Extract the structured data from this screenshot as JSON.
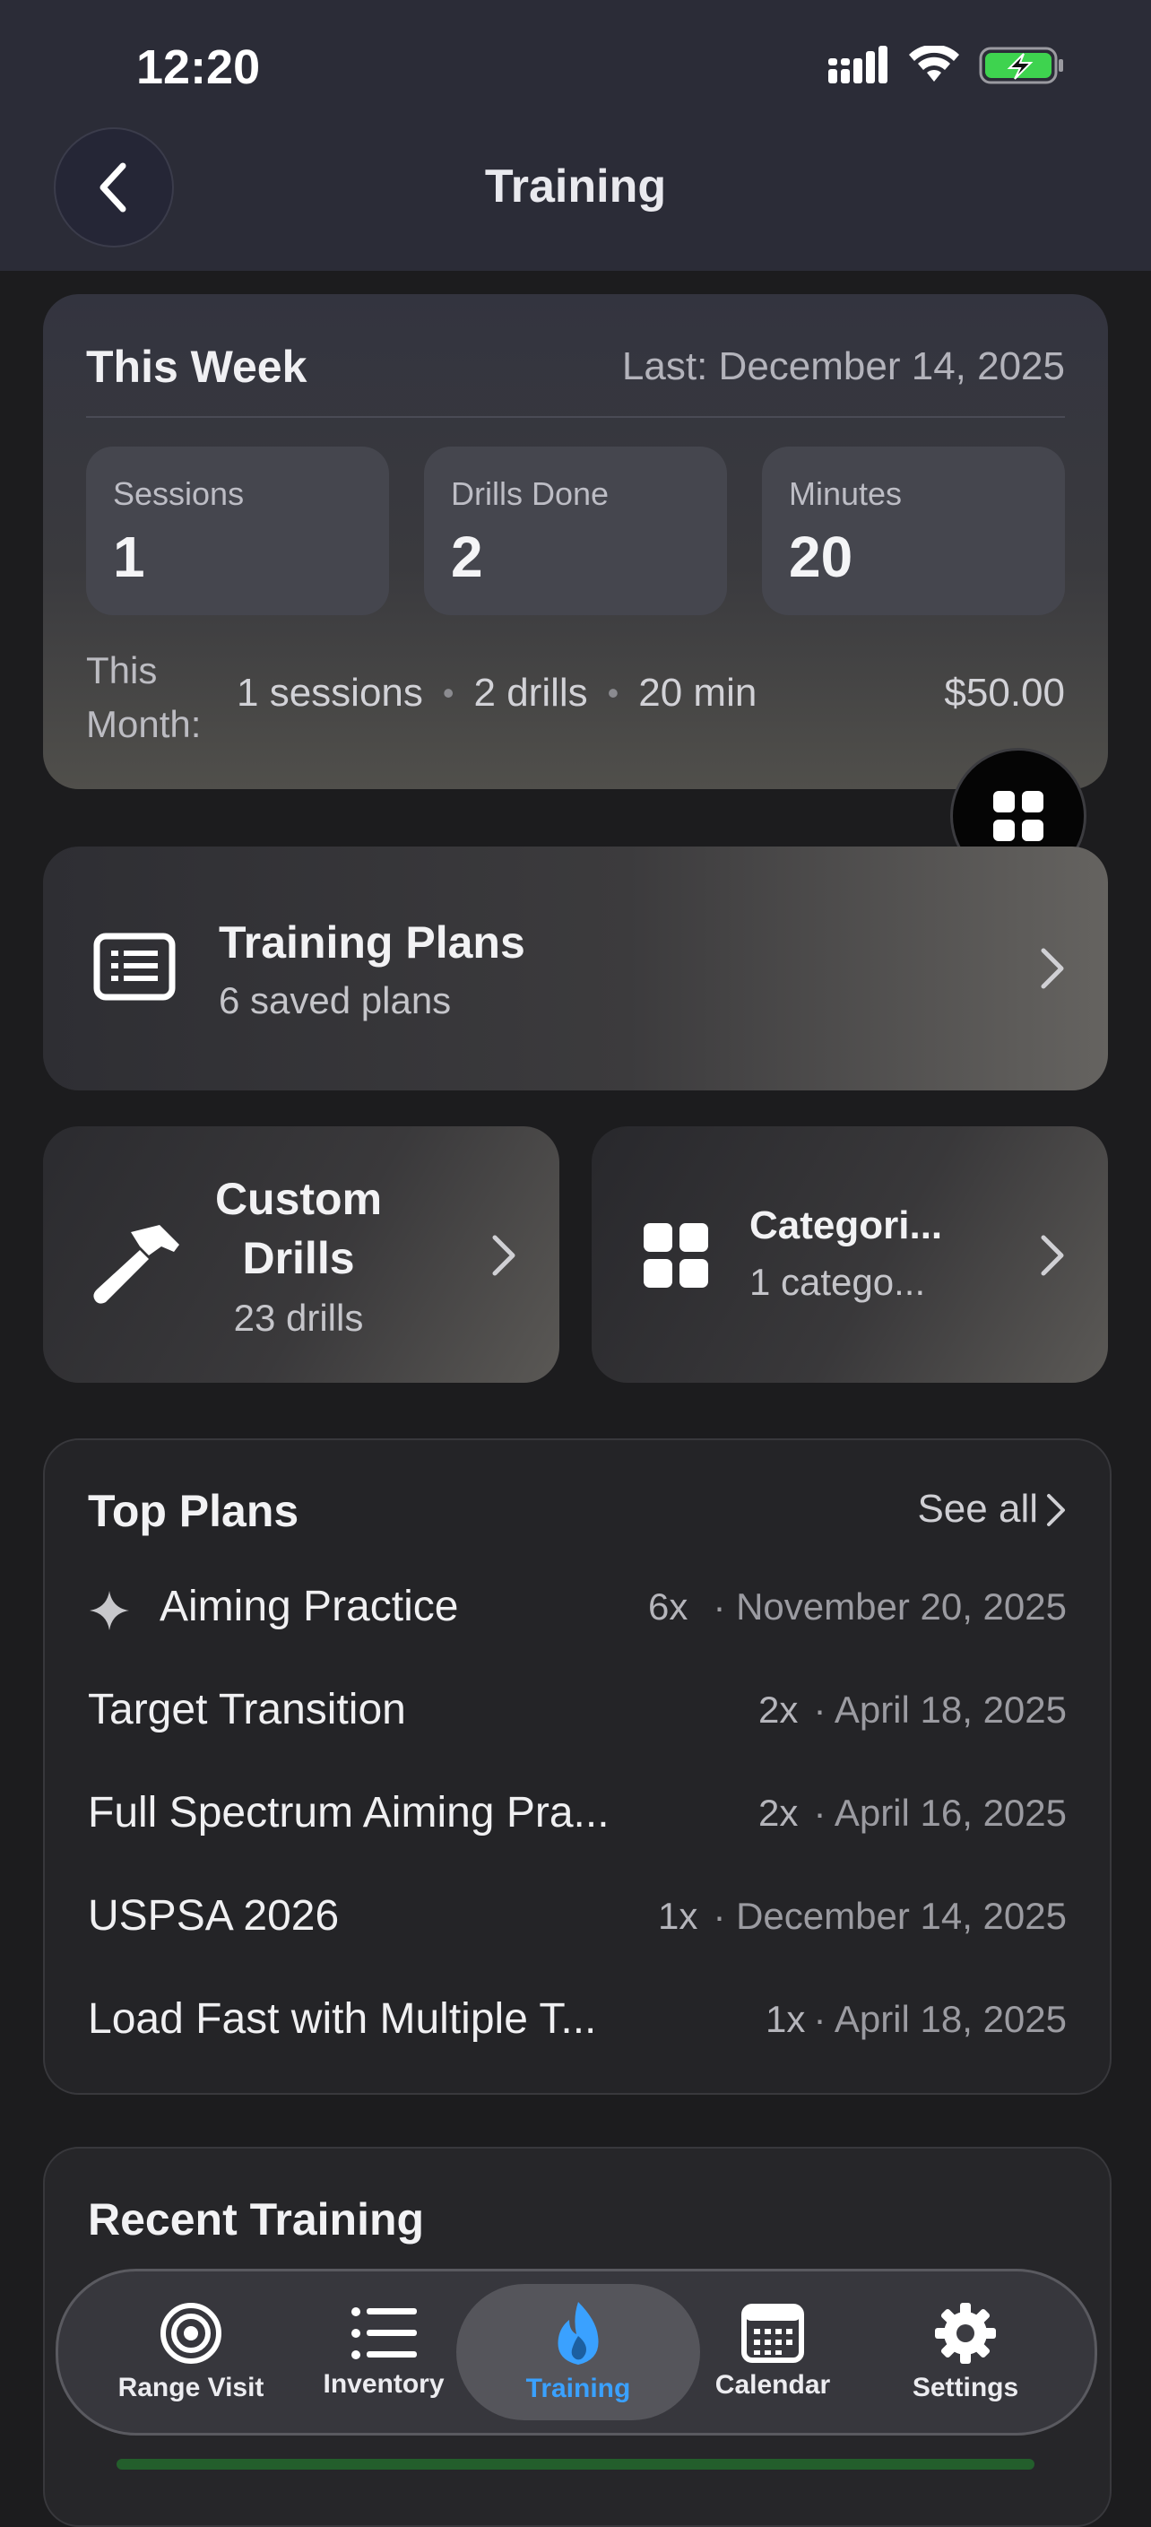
{
  "status_bar": {
    "time": "12:20"
  },
  "nav": {
    "title": "Training"
  },
  "this_week": {
    "title": "This Week",
    "last": "Last: December 14, 2025",
    "stats": [
      {
        "label": "Sessions",
        "value": "1"
      },
      {
        "label": "Drills Done",
        "value": "2"
      },
      {
        "label": "Minutes",
        "value": "20"
      }
    ],
    "month_label": "This Month:",
    "month_sessions": "1 sessions",
    "month_drills": "2 drills",
    "month_minutes": "20 min",
    "month_cost": "$50.00",
    "separator": "•"
  },
  "training_plans": {
    "title": "Training Plans",
    "subtitle": "6 saved plans"
  },
  "custom_drills": {
    "title": "Custom Drills",
    "subtitle": "23 drills"
  },
  "categories": {
    "title": "Categori...",
    "subtitle": "1 catego..."
  },
  "top_plans": {
    "title": "Top Plans",
    "see_all": "See all",
    "rows": [
      {
        "name": "Aiming Practice",
        "count": "6x",
        "date": "· November 20, 2025",
        "featured": true
      },
      {
        "name": "Target Transition",
        "count": "2x",
        "date": "· April 18, 2025"
      },
      {
        "name": "Full Spectrum Aiming Pra...",
        "count": "2x",
        "date": "· April 16, 2025"
      },
      {
        "name": "USPSA 2026",
        "count": "1x",
        "date": "· December 14, 2025"
      },
      {
        "name": "Load Fast with Multiple T...",
        "count": "1x",
        "date": "· April 18, 2025"
      }
    ]
  },
  "recent_training": {
    "title": "Recent Training"
  },
  "tab_bar": {
    "tabs": [
      {
        "label": "Range Visit",
        "icon": "target-icon"
      },
      {
        "label": "Inventory",
        "icon": "list-icon"
      },
      {
        "label": "Training",
        "icon": "flame-icon",
        "active": true
      },
      {
        "label": "Calendar",
        "icon": "calendar-icon"
      },
      {
        "label": "Settings",
        "icon": "gear-icon"
      }
    ],
    "active_color": "#3aa1ff"
  }
}
